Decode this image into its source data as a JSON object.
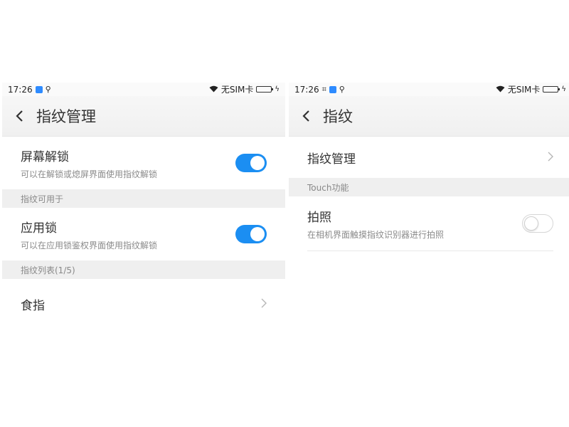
{
  "left_screen": {
    "status": {
      "time": "17:26",
      "carrier": "无SIM卡"
    },
    "title": "指纹管理",
    "items": [
      {
        "label": "屏幕解锁",
        "sub": "可以在解锁或熄屏界面使用指纹解锁",
        "toggle": "on"
      },
      {
        "section": "指纹可用于"
      },
      {
        "label": "应用锁",
        "sub": "可以在应用锁鉴权界面使用指纹解锁",
        "toggle": "on"
      },
      {
        "section": "指纹列表(1/5)"
      },
      {
        "label": "食指"
      }
    ]
  },
  "right_screen": {
    "status": {
      "time": "17:26",
      "carrier": "无SIM卡"
    },
    "title": "指纹",
    "items": [
      {
        "label": "指纹管理"
      },
      {
        "section": "Touch功能"
      },
      {
        "label": "拍照",
        "sub": "在相机界面触摸指纹识别器进行拍照",
        "toggle": "off"
      }
    ]
  },
  "colors": {
    "accent": "#1b8ef2",
    "section_bg": "#efefef",
    "battery": "#34c759"
  },
  "icons": [
    "back-arrow-icon",
    "chevron-right-icon",
    "wifi-icon",
    "usb-icon",
    "battery-icon",
    "app-notification-icon",
    "screenshot-icon"
  ]
}
